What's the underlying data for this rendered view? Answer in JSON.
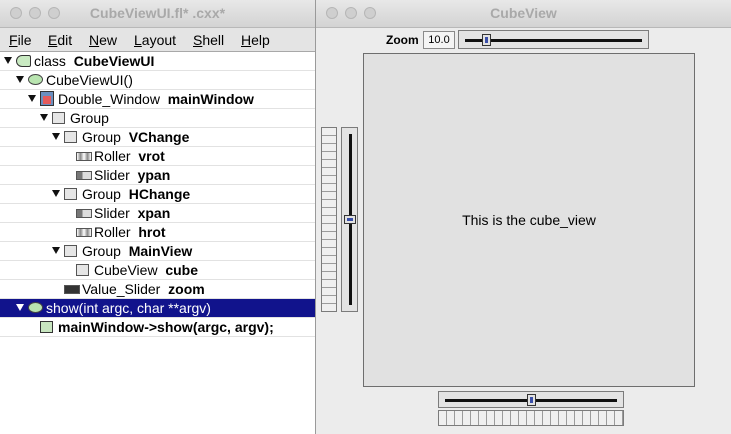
{
  "left_window": {
    "title": "CubeViewUI.fl* .cxx*",
    "menu": [
      {
        "label": "File",
        "underline": "F",
        "rest": "ile"
      },
      {
        "label": "Edit",
        "underline": "E",
        "rest": "dit"
      },
      {
        "label": "New",
        "underline": "N",
        "rest": "ew"
      },
      {
        "label": "Layout",
        "underline": "L",
        "rest": "ayout"
      },
      {
        "label": "Shell",
        "underline": "S",
        "rest": "hell"
      },
      {
        "label": "Help",
        "underline": "H",
        "rest": "elp"
      }
    ],
    "tree": [
      {
        "depth": 0,
        "expander": true,
        "icon": "class-icon",
        "type": "class",
        "name": "CubeViewUI",
        "selected": false
      },
      {
        "depth": 1,
        "expander": true,
        "icon": "function-icon",
        "type": "CubeViewUI()",
        "name": "",
        "selected": false
      },
      {
        "depth": 2,
        "expander": true,
        "icon": "window-icon",
        "type": "Double_Window",
        "name": "mainWindow",
        "selected": false
      },
      {
        "depth": 3,
        "expander": true,
        "icon": "group-icon",
        "type": "Group",
        "name": "",
        "selected": false
      },
      {
        "depth": 4,
        "expander": true,
        "icon": "group-icon",
        "type": "Group",
        "name": "VChange",
        "selected": false
      },
      {
        "depth": 5,
        "expander": false,
        "icon": "roller-icon",
        "type": "Roller",
        "name": "vrot",
        "selected": false
      },
      {
        "depth": 5,
        "expander": false,
        "icon": "slider-icon",
        "type": "Slider",
        "name": "ypan",
        "selected": false
      },
      {
        "depth": 4,
        "expander": true,
        "icon": "group-icon",
        "type": "Group",
        "name": "HChange",
        "selected": false
      },
      {
        "depth": 5,
        "expander": false,
        "icon": "slider-icon",
        "type": "Slider",
        "name": "xpan",
        "selected": false
      },
      {
        "depth": 5,
        "expander": false,
        "icon": "roller-icon",
        "type": "Roller",
        "name": "hrot",
        "selected": false
      },
      {
        "depth": 4,
        "expander": true,
        "icon": "group-icon",
        "type": "Group",
        "name": "MainView",
        "selected": false
      },
      {
        "depth": 5,
        "expander": false,
        "icon": "box-icon",
        "type": "CubeView",
        "name": "cube",
        "selected": false
      },
      {
        "depth": 4,
        "expander": false,
        "icon": "value-slider-icon",
        "type": "Value_Slider",
        "name": "zoom",
        "selected": false
      },
      {
        "depth": 1,
        "expander": true,
        "icon": "function-icon",
        "type": "show(int argc, char **argv)",
        "name": "",
        "selected": true
      },
      {
        "depth": 2,
        "expander": false,
        "icon": "code-icon",
        "type": "",
        "name": "mainWindow->show(argc, argv);",
        "selected": false
      }
    ]
  },
  "right_window": {
    "title": "CubeView",
    "zoom_label": "Zoom",
    "zoom_value": "10.0",
    "zoom_slider_fraction": 0.1,
    "ypan_slider_fraction": 0.5,
    "xpan_slider_fraction": 0.5,
    "cube_text": "This is the cube_view"
  },
  "colors": {
    "selection": "#11138c",
    "titlebar_text": "#a9a9a9",
    "slider_knob_accent": "#3a4fa8"
  }
}
